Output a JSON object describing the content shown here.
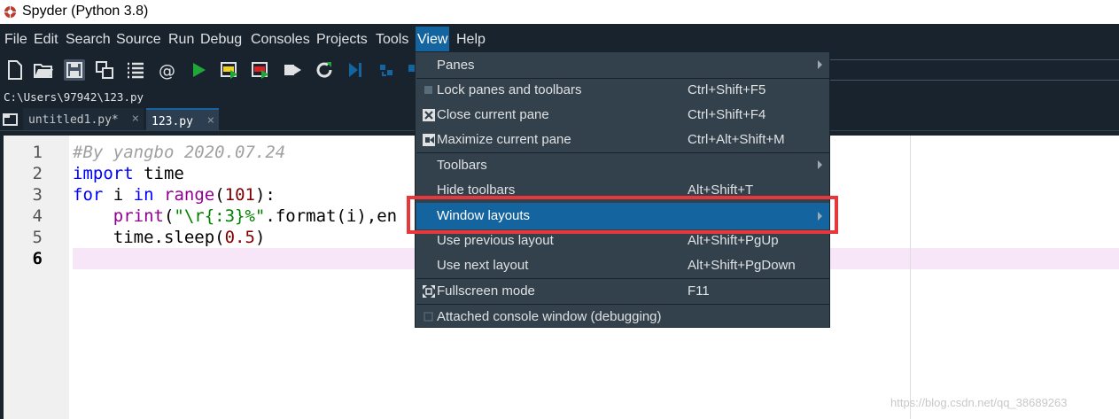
{
  "window": {
    "title": "Spyder (Python 3.8)"
  },
  "menubar": {
    "items": [
      "File",
      "Edit",
      "Search",
      "Source",
      "Run",
      "Debug",
      "Consoles",
      "Projects",
      "Tools",
      "View",
      "Help"
    ],
    "active": "View"
  },
  "toolbar": {
    "icons": [
      "new-file-icon",
      "open-folder-icon",
      "save-icon",
      "save-all-icon",
      "outline-icon",
      "email-icon",
      "run-icon",
      "run-cell-icon",
      "run-cell-advance-icon",
      "run-selection-icon",
      "rerun-icon",
      "debug-icon",
      "step-icon",
      "maximize-icon"
    ]
  },
  "path": "C:\\Users\\97942\\123.py",
  "tabs": [
    {
      "label": "untitled1.py*",
      "close": "×"
    },
    {
      "label": "123.py",
      "close": "×"
    }
  ],
  "editor": {
    "line_numbers": [
      "1",
      "2",
      "3",
      "4",
      "5",
      "6"
    ],
    "current_line": "6",
    "lines": [
      {
        "comment": "#By yangbo 2020.07.24"
      },
      {
        "kw": "import",
        "rest": " time"
      },
      {
        "kw1": "for",
        "t1": " i ",
        "kw2": "in",
        "t2": " ",
        "bi": "range",
        "t3": "(",
        "num": "101",
        "t4": "):"
      },
      {
        "indent": "    ",
        "bi": "print",
        "t1": "(",
        "str": "\"\\r{:3}%\"",
        "t2": ".format(i),en"
      },
      {
        "indent": "    ",
        "t1": "time.sleep(",
        "num": "0.5",
        "t2": ")"
      }
    ]
  },
  "view_menu": {
    "items": [
      {
        "label": "Panes",
        "shortcut": "",
        "submenu": true,
        "icon": ""
      },
      {
        "label": "Lock panes and toolbars",
        "shortcut": "Ctrl+Shift+F5",
        "submenu": false,
        "icon": "checkbox-icon"
      },
      {
        "label": "Close current pane",
        "shortcut": "Ctrl+Shift+F4",
        "submenu": false,
        "icon": "close-pane-icon"
      },
      {
        "label": "Maximize current pane",
        "shortcut": "Ctrl+Alt+Shift+M",
        "submenu": false,
        "icon": "maximize-pane-icon"
      },
      {
        "label": "Toolbars",
        "shortcut": "",
        "submenu": true,
        "icon": ""
      },
      {
        "label": "Hide toolbars",
        "shortcut": "Alt+Shift+T",
        "submenu": false,
        "icon": ""
      },
      {
        "label": "Window layouts",
        "shortcut": "",
        "submenu": true,
        "icon": "",
        "highlighted": true
      },
      {
        "label": "Use previous layout",
        "shortcut": "Alt+Shift+PgUp",
        "submenu": false,
        "icon": ""
      },
      {
        "label": "Use next layout",
        "shortcut": "Alt+Shift+PgDown",
        "submenu": false,
        "icon": ""
      },
      {
        "label": "Fullscreen mode",
        "shortcut": "F11",
        "submenu": false,
        "icon": "fullscreen-icon"
      },
      {
        "label": "Attached console window (debugging)",
        "shortcut": "",
        "submenu": false,
        "icon": "checkbox-icon"
      }
    ]
  },
  "watermark": "https://blog.csdn.net/qq_38689263",
  "colors": {
    "accent": "#1464a0",
    "highlight_box": "#e8373a",
    "bg": "#19232d",
    "menu_bg": "#32414b"
  }
}
